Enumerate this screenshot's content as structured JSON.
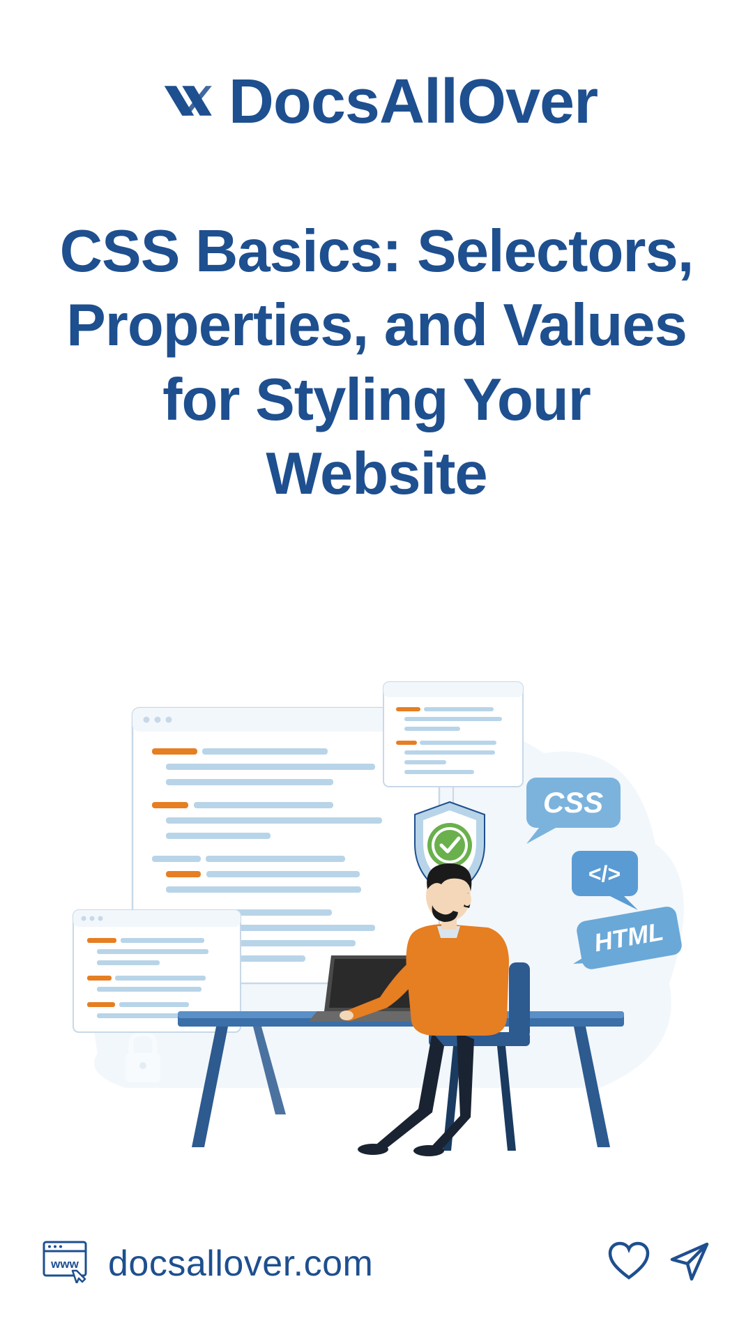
{
  "brand": "DocsAllOver",
  "title": "CSS Basics: Selectors, Properties, and Values for Styling Your Website",
  "url": "docsallover.com",
  "illustration": {
    "badges": [
      "CSS",
      "</>",
      "HTML"
    ]
  },
  "colors": {
    "primary": "#1e4f8f",
    "accent_orange": "#e67e22",
    "light_blue": "#b8d4e8",
    "badge_blue": "#5a9bd4",
    "shield_green": "#6ab04c"
  }
}
